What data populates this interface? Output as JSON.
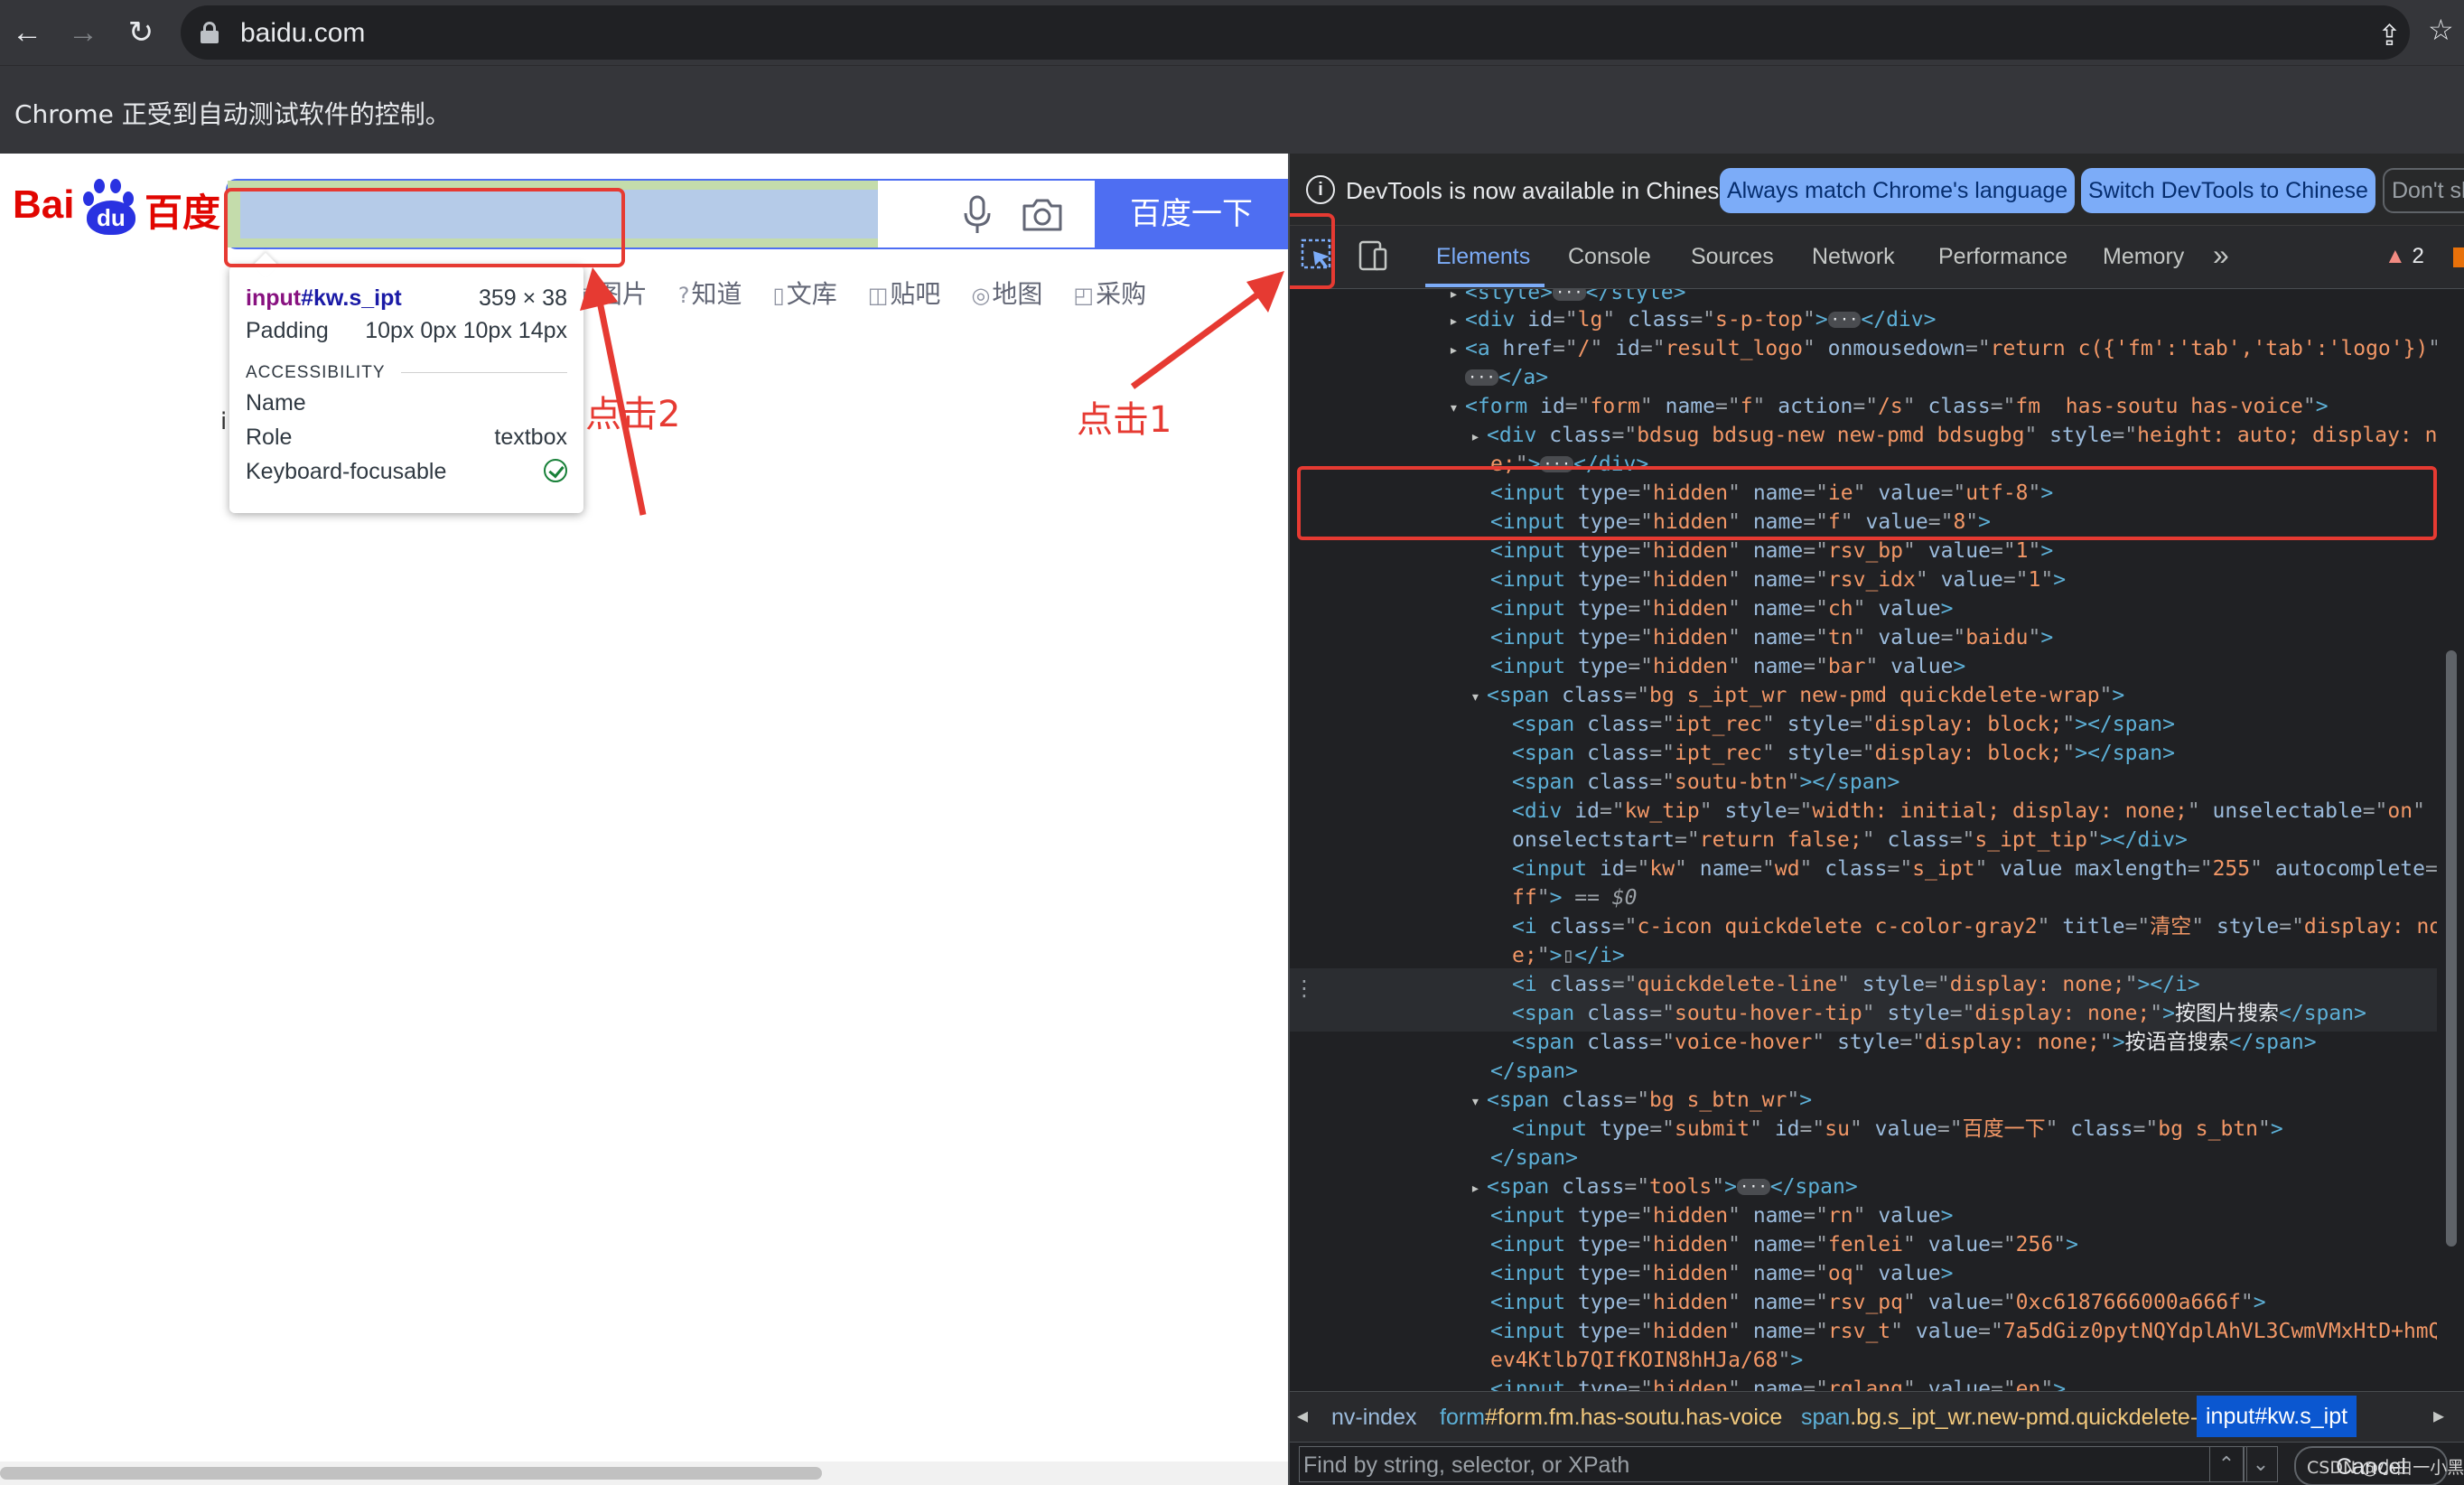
{
  "browser": {
    "url": "baidu.com",
    "automation_notice": "Chrome 正受到自动测试软件的控制。",
    "icons": [
      "back-icon",
      "forward-icon",
      "reload-icon",
      "lock-icon",
      "share-icon",
      "star-icon"
    ]
  },
  "baidu": {
    "logo_latin_1": "Bai",
    "logo_latin_2": "du",
    "logo_cn": "百度",
    "search_button": "百度一下",
    "search_value": "",
    "nav": [
      "图片",
      "知道",
      "文库",
      "贴吧",
      "地图",
      "采购"
    ],
    "clipped_char": "i",
    "brand_color": "#4e6ef2"
  },
  "tooltip": {
    "tag": "input",
    "selector": "#kw.s_ipt",
    "size": "359 × 38",
    "padding_label": "Padding",
    "padding_value": "10px 0px 10px 14px",
    "section": "ACCESSIBILITY",
    "name_label": "Name",
    "name_value": "",
    "role_label": "Role",
    "role_value": "textbox",
    "focusable_label": "Keyboard-focusable"
  },
  "annotations": {
    "click1": "点击1",
    "click2": "点击2",
    "color": "#e63a32"
  },
  "devtools": {
    "banner_text": "DevTools is now available in Chinese!",
    "banner_btn1": "Always match Chrome's language",
    "banner_btn2": "Switch DevTools to Chinese",
    "banner_btn3": "Don't sh",
    "tabs": [
      "Elements",
      "Console",
      "Sources",
      "Network",
      "Performance",
      "Memory"
    ],
    "more_tabs": "»",
    "warnings": "2",
    "crumbs": {
      "c1": "nv-index",
      "c2_tag": "form",
      "c2_rest": "#form.fm.has-soutu.has-voice",
      "c3_tag": "span",
      "c3_rest": ".bg.s_ipt_wr.new-pmd.quickdelete-wrap",
      "c4_tag": "input",
      "c4_rest": "#kw.s_ipt"
    },
    "filter_placeholder": "Find by string, selector, or XPath",
    "cancel_label": "Cancel",
    "watermark": "CSDN @小白一小黑"
  }
}
